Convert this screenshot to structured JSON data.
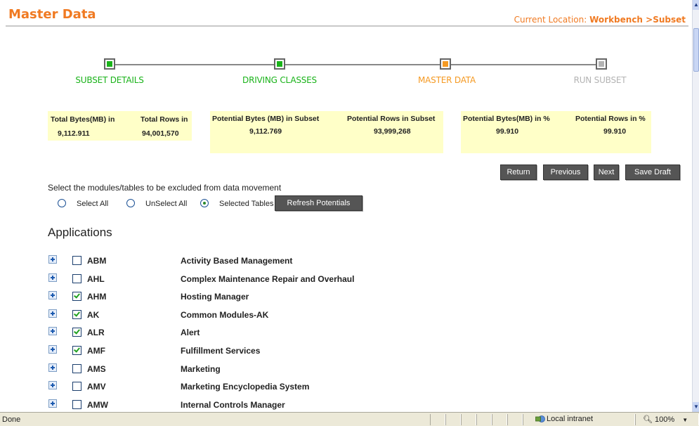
{
  "header": {
    "title": "Master Data",
    "location_prefix": "Current Location: ",
    "location_path": "Workbench >Subset"
  },
  "wizard": {
    "steps": [
      {
        "label": "SUBSET DETAILS",
        "state": "done",
        "color": "#1ab31a"
      },
      {
        "label": "DRIVING CLASSES",
        "state": "done",
        "color": "#1ab31a"
      },
      {
        "label": "MASTER DATA",
        "state": "current",
        "color": "#f59a23"
      },
      {
        "label": "RUN SUBSET",
        "state": "pending",
        "color": "#b3b3b3"
      }
    ]
  },
  "stats": {
    "total_bytes_label": "Total Bytes(MB) in",
    "total_bytes_value": "9,112.911",
    "total_rows_label": "Total Rows in",
    "total_rows_value": "94,001,570",
    "potential_bytes_label": "Potential Bytes (MB) in Subset",
    "potential_bytes_value": "9,112.769",
    "potential_rows_label": "Potential Rows in Subset",
    "potential_rows_value": "93,999,268",
    "potential_bytes_pct_label": "Potential Bytes(MB) in %",
    "potential_bytes_pct_value": "99.910",
    "potential_rows_pct_label": "Potential Rows in %",
    "potential_rows_pct_value": "99.910"
  },
  "nav_buttons": {
    "return": "Return",
    "previous": "Previous",
    "next": "Next",
    "save_draft": "Save Draft"
  },
  "selection": {
    "instruction": "Select the modules/tables to be excluded from data movement",
    "select_all": "Select All",
    "unselect_all": "UnSelect All",
    "selected_tables": "Selected Tables",
    "selected_option": "selected_tables",
    "refresh_button": "Refresh Potentials"
  },
  "applications": {
    "title": "Applications",
    "rows": [
      {
        "code": "ABM",
        "name": "Activity Based Management",
        "checked": false
      },
      {
        "code": "AHL",
        "name": "Complex Maintenance Repair and Overhaul",
        "checked": false
      },
      {
        "code": "AHM",
        "name": "Hosting Manager",
        "checked": true
      },
      {
        "code": "AK",
        "name": "Common Modules-AK",
        "checked": true
      },
      {
        "code": "ALR",
        "name": "Alert",
        "checked": true
      },
      {
        "code": "AMF",
        "name": "Fulfillment Services",
        "checked": true
      },
      {
        "code": "AMS",
        "name": "Marketing",
        "checked": false
      },
      {
        "code": "AMV",
        "name": "Marketing Encyclopedia System",
        "checked": false
      },
      {
        "code": "AMW",
        "name": "Internal Controls Manager",
        "checked": false
      }
    ]
  },
  "statusbar": {
    "status": "Done",
    "zone": "Local intranet",
    "zoom": "100%"
  },
  "colors": {
    "accent_orange": "#f07a22",
    "stat_bg": "#ffffc8",
    "button_bg": "#555555"
  }
}
